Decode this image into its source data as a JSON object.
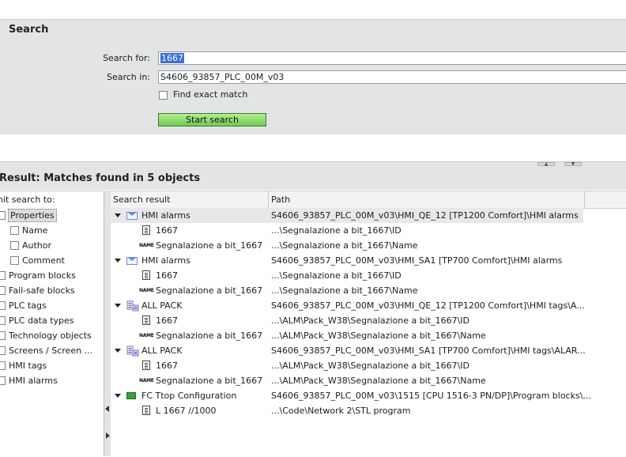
{
  "search": {
    "title": "Search",
    "search_for_label": "Search for:",
    "search_for_value": "1667",
    "search_in_label": "Search in:",
    "search_in_value": "S4606_93857_PLC_00M_v03",
    "exact_match_label": "Find exact match",
    "exact_match_checked": false,
    "start_button": "Start search"
  },
  "result": {
    "title": "Result: Matches found in 5 objects"
  },
  "filter": {
    "label": "Limit search to:",
    "items": [
      {
        "label": "Properties",
        "level": 0
      },
      {
        "label": "Name",
        "level": 1
      },
      {
        "label": "Author",
        "level": 1
      },
      {
        "label": "Comment",
        "level": 1
      },
      {
        "label": "Program blocks",
        "level": 0
      },
      {
        "label": "Fail-safe blocks",
        "level": 0
      },
      {
        "label": "PLC tags",
        "level": 0
      },
      {
        "label": "PLC data types",
        "level": 0
      },
      {
        "label": "Technology objects",
        "level": 0
      },
      {
        "label": "Screens / Screen ...",
        "level": 0
      },
      {
        "label": "HMI tags",
        "level": 0
      },
      {
        "label": "HMI alarms",
        "level": 0
      }
    ]
  },
  "table": {
    "col_result": "Search result",
    "col_path": "Path",
    "rows": [
      {
        "level": 0,
        "icon": "envelope-icon",
        "name": "HMI alarms",
        "path": "S4606_93857_PLC_00M_v03\\HMI_QE_12 [TP1200 Comfort]\\HMI alarms"
      },
      {
        "level": 1,
        "icon": "document-icon",
        "name": "1667",
        "path": "...\\Segnalazione a bit_1667\\ID"
      },
      {
        "level": 1,
        "icon": "name-icon",
        "name": "Segnalazione a bit_1667",
        "path": "...\\Segnalazione a bit_1667\\Name"
      },
      {
        "level": 0,
        "icon": "envelope-icon",
        "name": "HMI alarms",
        "path": "S4606_93857_PLC_00M_v03\\HMI_SA1 [TP700 Comfort]\\HMI alarms"
      },
      {
        "level": 1,
        "icon": "document-icon",
        "name": "1667",
        "path": "...\\Segnalazione a bit_1667\\ID"
      },
      {
        "level": 1,
        "icon": "name-icon",
        "name": "Segnalazione a bit_1667",
        "path": "...\\Segnalazione a bit_1667\\Name"
      },
      {
        "level": 0,
        "icon": "tag-table-icon",
        "name": "ALL PACK",
        "path": "S4606_93857_PLC_00M_v03\\HMI_QE_12 [TP1200 Comfort]\\HMI tags\\A..."
      },
      {
        "level": 1,
        "icon": "document-icon",
        "name": "1667",
        "path": "...\\ALM\\Pack_W38\\Segnalazione a bit_1667\\ID"
      },
      {
        "level": 1,
        "icon": "name-icon",
        "name": "Segnalazione a bit_1667",
        "path": "...\\ALM\\Pack_W38\\Segnalazione a bit_1667\\Name"
      },
      {
        "level": 0,
        "icon": "tag-table-icon",
        "name": "ALL PACK",
        "path": "S4606_93857_PLC_00M_v03\\HMI_SA1 [TP700 Comfort]\\HMI tags\\ALAR..."
      },
      {
        "level": 1,
        "icon": "document-icon",
        "name": "1667",
        "path": "...\\ALM\\Pack_W38\\Segnalazione a bit_1667\\ID"
      },
      {
        "level": 1,
        "icon": "name-icon",
        "name": "Segnalazione a bit_1667",
        "path": "...\\ALM\\Pack_W38\\Segnalazione a bit_1667\\Name"
      },
      {
        "level": 0,
        "icon": "function-block-icon",
        "name": "FC Ttop Configuration",
        "path": "S4606_93857_PLC_00M_v03\\1515 [CPU 1516-3 PN/DP]\\Program blocks\\..."
      },
      {
        "level": 1,
        "icon": "document-icon",
        "name": "L 1667 //1000",
        "path": "...\\Code\\Network 2\\STL program"
      }
    ]
  },
  "colors": {
    "panel_bg": "#e3e4e6",
    "start_button": "#8edb6a",
    "selection": "#3d6fd6"
  }
}
